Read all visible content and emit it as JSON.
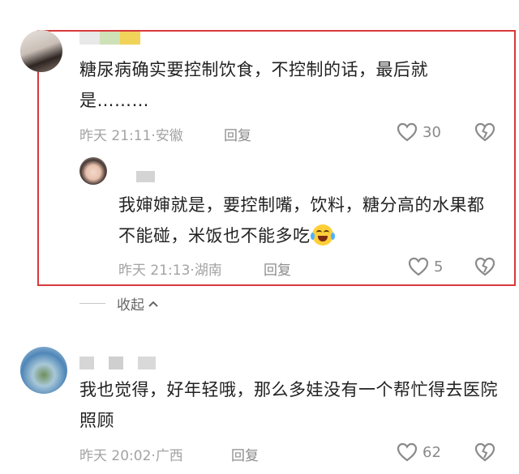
{
  "comment1": {
    "text": "糖尿病确实要控制饮食，不控制的话，最后就是………",
    "time": "昨天 21:11",
    "location": "安徽",
    "reply_label": "回复",
    "likes": "30"
  },
  "reply1": {
    "text": "我婶婶就是，要控制嘴，饮料，糖分高的水果都不能碰，米饭也不能多吃",
    "emoji": "crying-laughing-emoji",
    "time": "昨天 21:13",
    "location": "湖南",
    "reply_label": "回复",
    "likes": "5"
  },
  "collapse_label": "收起",
  "comment2": {
    "text": "我也觉得，好年轻哦，那么多娃没有一个帮忙得去医院照顾",
    "time": "昨天 20:02",
    "location": "广西",
    "reply_label": "回复",
    "likes": "62"
  },
  "colors": {
    "highlight_border": "#d9383a",
    "meta": "#a3a3a3"
  }
}
